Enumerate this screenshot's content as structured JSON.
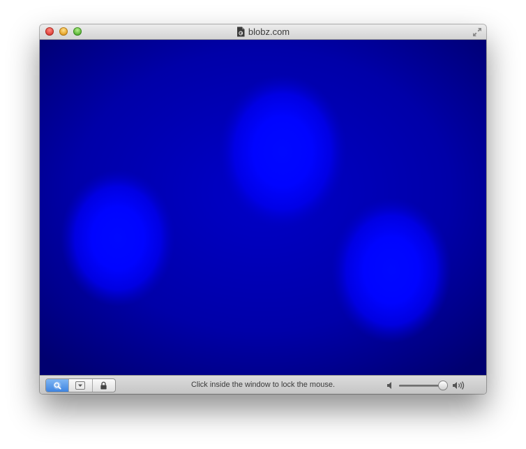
{
  "window": {
    "title": "blobz.com",
    "buttons": {
      "close": "close",
      "minimize": "minimize",
      "zoom": "zoom"
    },
    "icons": {
      "document": "document-icon",
      "fullscreen": "fullscreen-icon"
    }
  },
  "canvas": {
    "background_color": "#000077",
    "blob_color": "#0000ff",
    "blob_count": 3
  },
  "statusbar": {
    "message": "Click inside the window to lock the mouse.",
    "toolbar_icons": [
      "search-icon",
      "dropdown-icon",
      "lock-icon"
    ],
    "active_tool": "search",
    "volume_level": 0.9,
    "volume_icons": {
      "low": "speaker-low-icon",
      "high": "speaker-high-icon"
    }
  },
  "colors": {
    "accent": "#3e84e0",
    "traffic_close": "#e0443e",
    "traffic_minimize": "#e6a52b",
    "traffic_zoom": "#5cb83a"
  }
}
